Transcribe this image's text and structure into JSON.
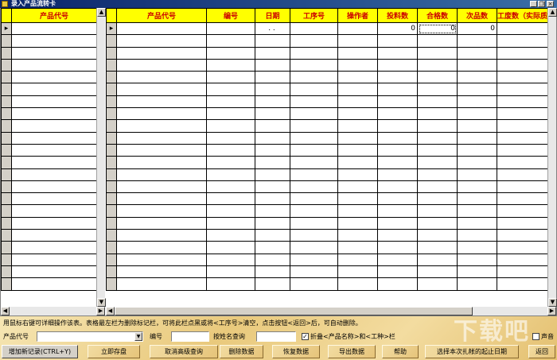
{
  "window": {
    "title": "录入产品流转卡"
  },
  "left_grid": {
    "header": "产品代号",
    "rows": 22
  },
  "right_grid": {
    "columns": [
      "产品代号",
      "编号",
      "日期",
      "工序号",
      "操作者",
      "投料数",
      "合格数",
      "次品数",
      "工废数（实际质量"
    ],
    "first_row": {
      "product_code": "",
      "number": "",
      "date": "  .  .",
      "process_no": "",
      "operator": "",
      "feed_qty": "0",
      "pass_qty": "0",
      "defect_qty": "0",
      "scrap_qty": "0"
    },
    "rows": 22
  },
  "hint": "用鼠标右键可详细操作该表。表格最左栏为删除标记栏，可将此栏点黑或将<工序号>清空，点击按钮<返回>后，可自动删除。",
  "filters": {
    "product_code_label": "产品代号",
    "number_label": "编号",
    "name_search_label": "按姓名查询",
    "fold_checkbox_label": "折叠<产品名称>和<工种>栏",
    "sound_label": "声音"
  },
  "buttons": {
    "add": "增加新记录(CTRL+Y)",
    "save": "立即存盘",
    "cancel_advanced": "取消高级查询",
    "delete": "删除数据",
    "restore": "恢复数据",
    "export": "导出数据",
    "help": "帮助",
    "select_date": "选择本次扎帐的起止日期",
    "back": "返回"
  },
  "watermark": "下载吧"
}
